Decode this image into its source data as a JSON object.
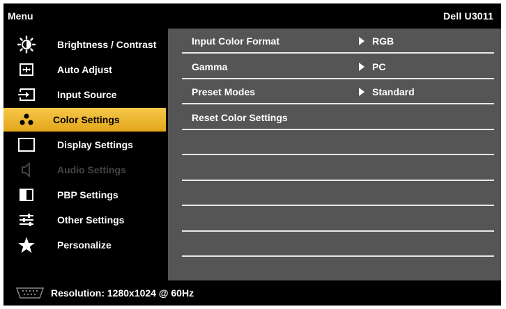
{
  "header": {
    "menu_label": "Menu",
    "model": "Dell U3011"
  },
  "sidebar": {
    "items": [
      {
        "label": "Brightness / Contrast",
        "icon": "brightness-icon",
        "state": "normal"
      },
      {
        "label": "Auto Adjust",
        "icon": "auto-adjust-icon",
        "state": "normal"
      },
      {
        "label": "Input Source",
        "icon": "input-source-icon",
        "state": "normal"
      },
      {
        "label": "Color Settings",
        "icon": "color-settings-icon",
        "state": "selected"
      },
      {
        "label": "Display Settings",
        "icon": "display-settings-icon",
        "state": "normal"
      },
      {
        "label": "Audio Settings",
        "icon": "speaker-icon",
        "state": "disabled"
      },
      {
        "label": "PBP Settings",
        "icon": "pbp-icon",
        "state": "normal"
      },
      {
        "label": "Other Settings",
        "icon": "sliders-icon",
        "state": "normal"
      },
      {
        "label": "Personalize",
        "icon": "star-icon",
        "state": "normal"
      }
    ]
  },
  "panel": {
    "rows": [
      {
        "name": "Input Color Format",
        "value": "RGB"
      },
      {
        "name": "Gamma",
        "value": "PC"
      },
      {
        "name": "Preset Modes",
        "value": "Standard"
      },
      {
        "name": "Reset Color Settings",
        "value": ""
      },
      {
        "name": "",
        "value": ""
      },
      {
        "name": "",
        "value": ""
      },
      {
        "name": "",
        "value": ""
      },
      {
        "name": "",
        "value": ""
      },
      {
        "name": "",
        "value": ""
      }
    ]
  },
  "footer": {
    "connector_icon": "vga-connector-icon",
    "resolution": "Resolution: 1280x1024 @ 60Hz"
  },
  "colors": {
    "selected": "#f0b930",
    "panel": "#555555",
    "background": "#000000",
    "disabled": "#444444"
  }
}
